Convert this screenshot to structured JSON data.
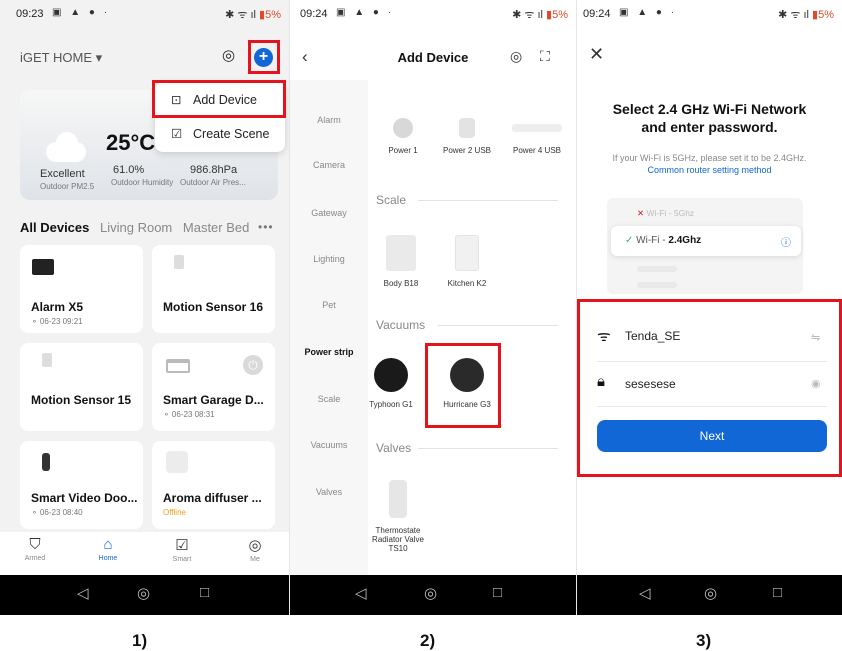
{
  "screens": [
    {
      "status": {
        "time": "09:23",
        "icons": "▣ ▲ ● ·",
        "right": "✱ ᯤ ıl",
        "battery": "▮5%"
      },
      "home_title": "iGET HOME ▾",
      "menu": {
        "add_device": "Add Device",
        "create_scene": "Create Scene"
      },
      "weather": {
        "temperature": "25°C",
        "quality": "Excellent",
        "quality_sub": "Outdoor PM2.5",
        "humidity": "61.0%",
        "humidity_sub": "Outdoor Humidity",
        "pressure": "986.8hPa",
        "pressure_sub": "Outdoor Air Pres..."
      },
      "tabs": [
        "All Devices",
        "Living Room",
        "Master Bed"
      ],
      "tabs_more": "•••",
      "devices": [
        {
          "name": "Alarm X5",
          "sub": "⚬ 06-23 09:21"
        },
        {
          "name": "Motion Sensor 16",
          "sub": ""
        },
        {
          "name": "Motion Sensor 15",
          "sub": ""
        },
        {
          "name": "Smart Garage D...",
          "sub": "⚬ 06-23 08:31"
        },
        {
          "name": "Smart Video Doo...",
          "sub": "⚬ 06-23 08:40"
        },
        {
          "name": "Aroma diffuser ...",
          "sub": "Offline"
        }
      ],
      "bottom_nav": [
        "Armed",
        "Home",
        "Smart",
        "Me"
      ],
      "caption": "1)"
    },
    {
      "status": {
        "time": "09:24",
        "icons": "▣ ▲ ● ·",
        "right": "✱ ᯤ ıl",
        "battery": "▮5%"
      },
      "title": "Add Device",
      "categories": [
        "Alarm",
        "Camera",
        "Gateway",
        "Lighting",
        "Pet",
        "Power strip",
        "Scale",
        "Vacuums",
        "Valves"
      ],
      "power_products": [
        "Power 1",
        "Power 2 USB",
        "Power 4 USB"
      ],
      "sections": {
        "scale": "Scale",
        "vacuums": "Vacuums",
        "valves": "Valves"
      },
      "scale_products": [
        "Body B18",
        "Kitchen K2"
      ],
      "vacuum_products": [
        "Typhoon G1",
        "Hurricane G3"
      ],
      "valve_products": [
        "Thermostate Radiator Valve TS10"
      ],
      "caption": "2)"
    },
    {
      "status": {
        "time": "09:24",
        "icons": "▣ ▲ ● ·",
        "right": "✱ ᯤ ıl",
        "battery": "▮5%"
      },
      "heading_line1": "Select 2.4 GHz Wi-Fi Network",
      "heading_line2": "and enter password.",
      "hint": "If your Wi-Fi is 5GHz, please set it to be 2.4GHz.",
      "link": "Common router setting method",
      "illus_5g": "Wi-Fi - 5Ghz",
      "illus_24_prefix": "Wi-Fi - ",
      "illus_24_band": "2.4Ghz",
      "ssid": "Tenda_SE",
      "password": "sesesese",
      "next": "Next",
      "caption": "3)"
    }
  ],
  "colors": {
    "accent": "#1167d6",
    "highlight": "#e3141b",
    "offline": "#e8a317"
  }
}
